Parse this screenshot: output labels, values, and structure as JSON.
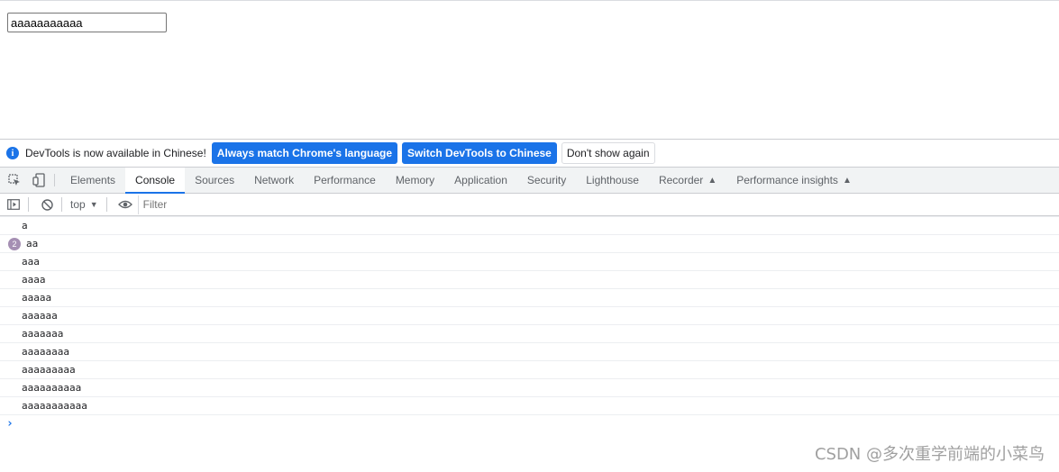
{
  "page": {
    "input_value": "aaaaaaaaaaa"
  },
  "infobar": {
    "icon": "info-icon",
    "message": "DevTools is now available in Chinese!",
    "btn_match": "Always match Chrome's language",
    "btn_switch": "Switch DevTools to Chinese",
    "btn_dismiss": "Don't show again"
  },
  "tabs": {
    "elements": "Elements",
    "console": "Console",
    "sources": "Sources",
    "network": "Network",
    "performance": "Performance",
    "memory": "Memory",
    "application": "Application",
    "security": "Security",
    "lighthouse": "Lighthouse",
    "recorder": "Recorder",
    "performance_insights": "Performance insights",
    "active": "Console"
  },
  "console_toolbar": {
    "context": "top",
    "filter_placeholder": "Filter"
  },
  "messages": [
    {
      "text": "a"
    },
    {
      "text": "aa",
      "count": "2"
    },
    {
      "text": "aaa"
    },
    {
      "text": "aaaa"
    },
    {
      "text": "aaaaa"
    },
    {
      "text": "aaaaaa"
    },
    {
      "text": "aaaaaaa"
    },
    {
      "text": "aaaaaaaa"
    },
    {
      "text": "aaaaaaaaa"
    },
    {
      "text": "aaaaaaaaaa"
    },
    {
      "text": "aaaaaaaaaaa"
    }
  ],
  "prompt": "›",
  "watermark": "CSDN @多次重学前端的小菜鸟",
  "colors": {
    "accent": "#1a73e8",
    "repeat_badge": "#a58fb3"
  }
}
